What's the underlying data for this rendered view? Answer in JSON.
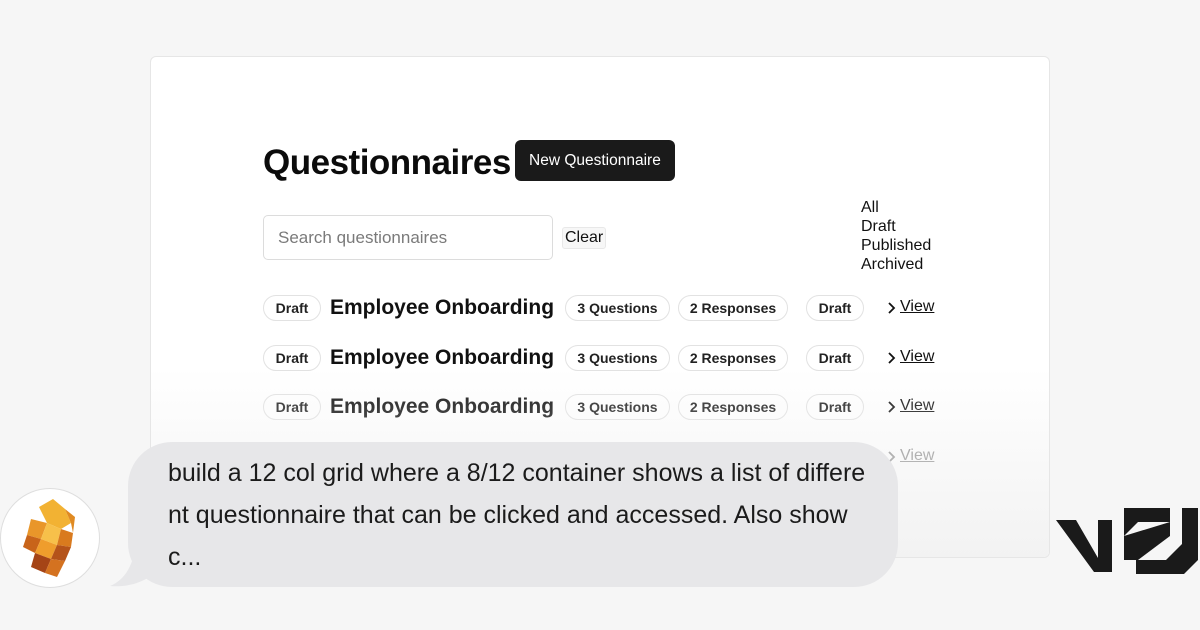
{
  "page": {
    "title": "Questionnaires",
    "new_button": "New Questionnaire",
    "search_placeholder": "Search questionnaires",
    "clear_button": "Clear",
    "filters": [
      "All",
      "Draft",
      "Published",
      "Archived"
    ]
  },
  "rows": [
    {
      "badge": "Draft",
      "title": "Employee Onboarding",
      "questions": "3 Questions",
      "responses": "2 Responses",
      "status": "Draft",
      "link": "View"
    },
    {
      "badge": "Draft",
      "title": "Employee Onboarding",
      "questions": "3 Questions",
      "responses": "2 Responses",
      "status": "Draft",
      "link": "View"
    },
    {
      "badge": "Draft",
      "title": "Employee Onboarding",
      "questions": "3 Questions",
      "responses": "2 Responses",
      "status": "Draft",
      "link": "View"
    },
    {
      "link": "View"
    }
  ],
  "chat": {
    "message": "build a 12 col grid where a 8/12 container shows a list of different questionnaire that can be clicked and accessed. Also show c..."
  },
  "icons": {
    "avatar": "lion-avatar-icon",
    "brand": "v0-logo-icon",
    "row_chevron": "chevron-right-icon"
  },
  "colors": {
    "primary_button": "#1a1a1a",
    "bubble": "#e7e7e9",
    "background": "#f6f6f6"
  }
}
